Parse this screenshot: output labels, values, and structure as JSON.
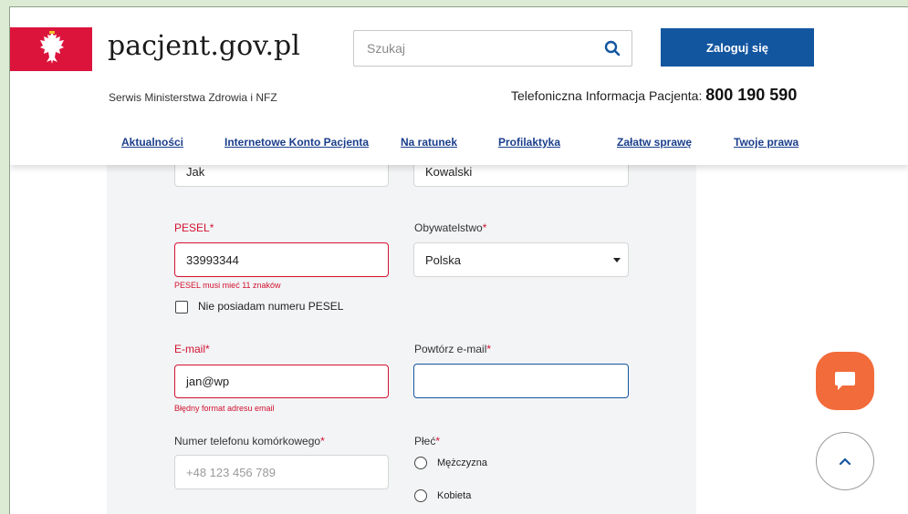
{
  "header": {
    "site_title": "pacjent.gov.pl",
    "subtitle": "Serwis Ministerstwa Zdrowia i NFZ",
    "search_placeholder": "Szukaj",
    "login_label": "Zaloguj się",
    "phone_label": "Telefoniczna Informacja Pacjenta:",
    "phone_number": "800 190 590"
  },
  "nav": [
    {
      "label": "Aktualności"
    },
    {
      "label": "Internetowe Konto Pacjenta"
    },
    {
      "label": "Na ratunek"
    },
    {
      "label": "Profilaktyka"
    },
    {
      "label": "Załatw sprawę"
    },
    {
      "label": "Twoje prawa"
    }
  ],
  "form": {
    "first_name_value": "Jak",
    "last_name_value": "Kowalski",
    "pesel": {
      "label": "PESEL",
      "required": "*",
      "value": "33993344",
      "error": "PESEL musi mieć 11 znaków"
    },
    "citizenship": {
      "label": "Obywatelstwo",
      "required": "*",
      "value": "Polska"
    },
    "no_pesel_label": "Nie posiadam numeru PESEL",
    "email": {
      "label": "E-mail",
      "required": "*",
      "value": "jan@wp",
      "error": "Błędny format adresu email"
    },
    "repeat_email": {
      "label": "Powtórz e-mail",
      "required": "*",
      "value": ""
    },
    "phone": {
      "label": "Numer telefonu komórkowego",
      "required": "*",
      "placeholder": "+48 123 456 789"
    },
    "gender": {
      "label": "Płeć",
      "required": "*",
      "options": [
        "Mężczyzna",
        "Kobieta"
      ]
    }
  },
  "colors": {
    "brand_blue": "#1356a0",
    "error_red": "#d4122f",
    "emblem_red": "#dc143c",
    "chat_orange": "#f26b3a"
  },
  "icons": {
    "emblem": "polish-eagle-icon",
    "search": "search-icon",
    "chat": "chat-icon",
    "scroll_top": "chevron-up-icon"
  }
}
